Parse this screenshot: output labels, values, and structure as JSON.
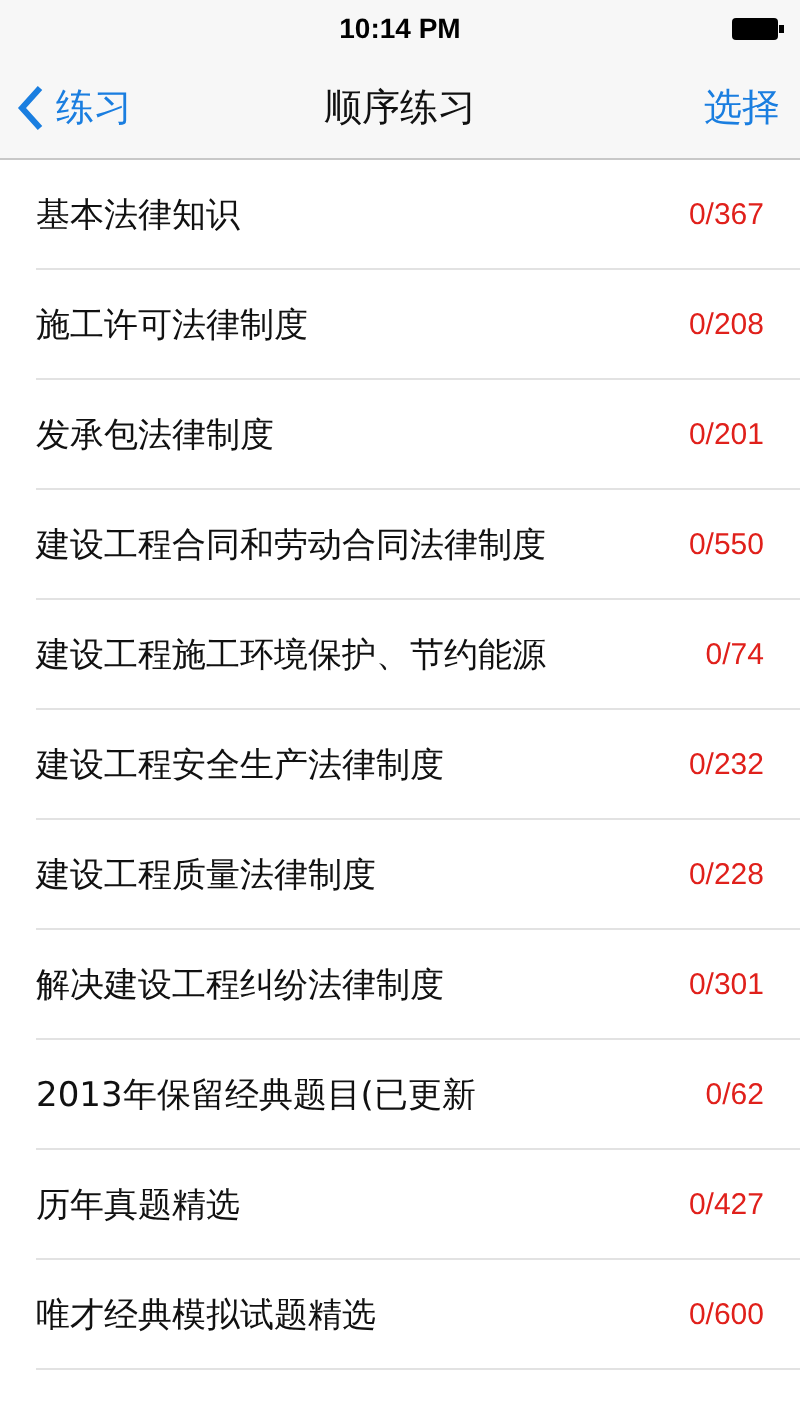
{
  "status_bar": {
    "time": "10:14 PM"
  },
  "nav": {
    "back": "练习",
    "title": "顺序练习",
    "action": "选择"
  },
  "rows": [
    {
      "title": "基本法律知识",
      "count": "0/367"
    },
    {
      "title": "施工许可法律制度",
      "count": "0/208"
    },
    {
      "title": "发承包法律制度",
      "count": "0/201"
    },
    {
      "title": "建设工程合同和劳动合同法律制度",
      "count": "0/550"
    },
    {
      "title": "建设工程施工环境保护、节约能源",
      "count": "0/74"
    },
    {
      "title": "建设工程安全生产法律制度",
      "count": "0/232"
    },
    {
      "title": "建设工程质量法律制度",
      "count": "0/228"
    },
    {
      "title": "解决建设工程纠纷法律制度",
      "count": "0/301"
    },
    {
      "title": "2013年保留经典题目(已更新",
      "count": "0/62"
    },
    {
      "title": "历年真题精选",
      "count": "0/427"
    },
    {
      "title": "唯才经典模拟试题精选",
      "count": "0/600"
    }
  ]
}
